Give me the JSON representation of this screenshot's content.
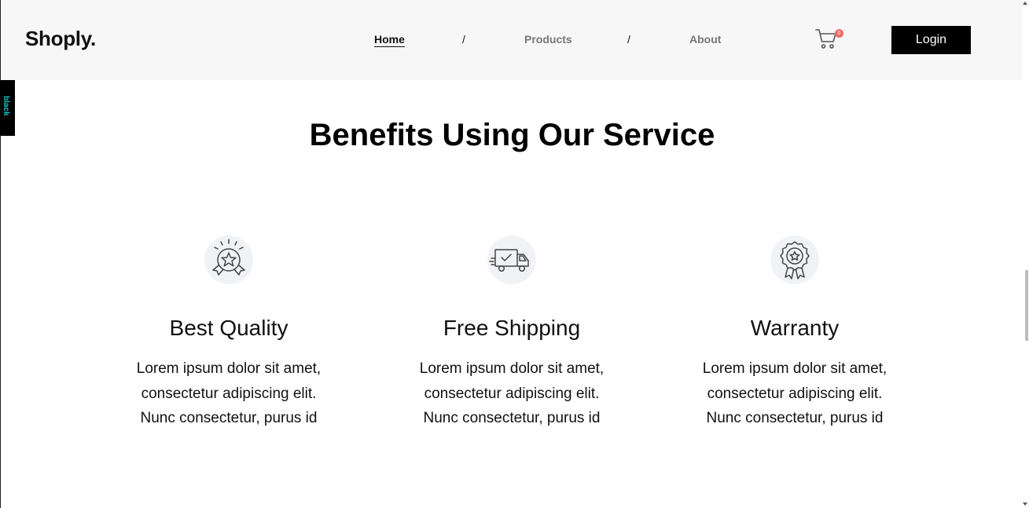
{
  "brand": {
    "logo": "Shoply."
  },
  "nav": {
    "home": "Home",
    "separator": "/",
    "products": "Products",
    "about": "About"
  },
  "cart": {
    "count": "0",
    "icon": "cart-icon"
  },
  "login": {
    "label": "Login"
  },
  "side_tab": {
    "label": "black"
  },
  "section": {
    "title": "Benefits Using Our Service"
  },
  "benefits": [
    {
      "icon": "award-star-icon",
      "title": "Best Quality",
      "text": "Lorem ipsum dolor sit amet, consectetur adipiscing elit. Nunc consectetur, purus id"
    },
    {
      "icon": "delivery-truck-icon",
      "title": "Free Shipping",
      "text": "Lorem ipsum dolor sit amet, consectetur adipiscing elit. Nunc consectetur, purus id"
    },
    {
      "icon": "warranty-badge-icon",
      "title": "Warranty",
      "text": "Lorem ipsum dolor sit amet, consectetur adipiscing elit. Nunc consectetur, purus id"
    }
  ],
  "colors": {
    "header_bg": "#f7f7f7",
    "accent_badge": "#f06b6b",
    "side_tab_text": "#16c4c8",
    "button_bg": "#000000"
  }
}
